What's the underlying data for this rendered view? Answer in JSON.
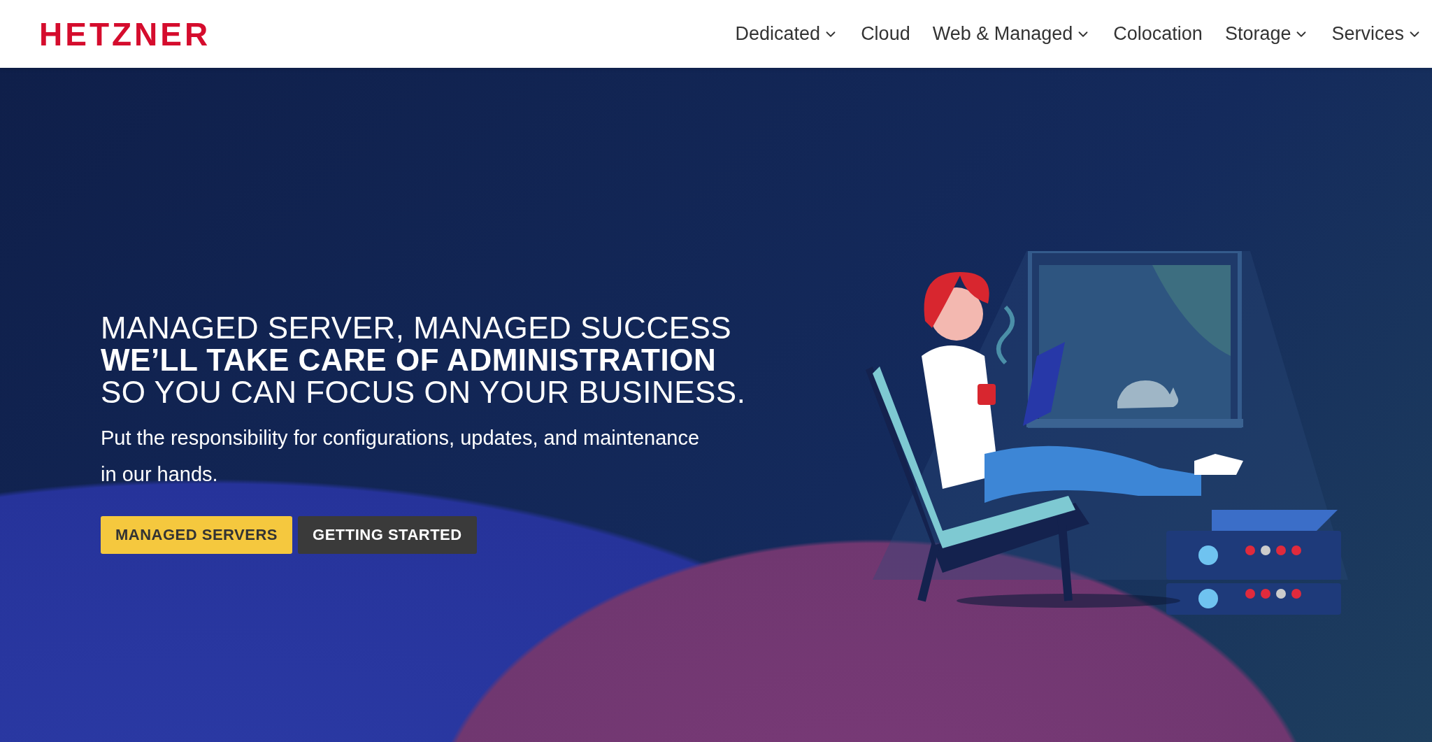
{
  "header": {
    "logo": "HETZNER",
    "nav": [
      {
        "label": "Dedicated",
        "has_dropdown": true
      },
      {
        "label": "Cloud",
        "has_dropdown": false
      },
      {
        "label": "Web & Managed",
        "has_dropdown": true
      },
      {
        "label": "Colocation",
        "has_dropdown": false
      },
      {
        "label": "Storage",
        "has_dropdown": true
      },
      {
        "label": "Services",
        "has_dropdown": true
      }
    ]
  },
  "hero": {
    "heading": "MANAGED SERVER, MANAGED SUCCESS\n**WE’LL TAKE CARE OF ADMINISTRATION**\nSO YOU CAN FOCUS ON YOUR BUSINESS.",
    "text": "Put the responsibility for configurations, updates, and maintenance in our hands.",
    "buttons": [
      {
        "label": "MANAGED SERVERS",
        "kind": "primary"
      },
      {
        "label": "GETTING STARTED",
        "kind": "secondary"
      }
    ]
  }
}
